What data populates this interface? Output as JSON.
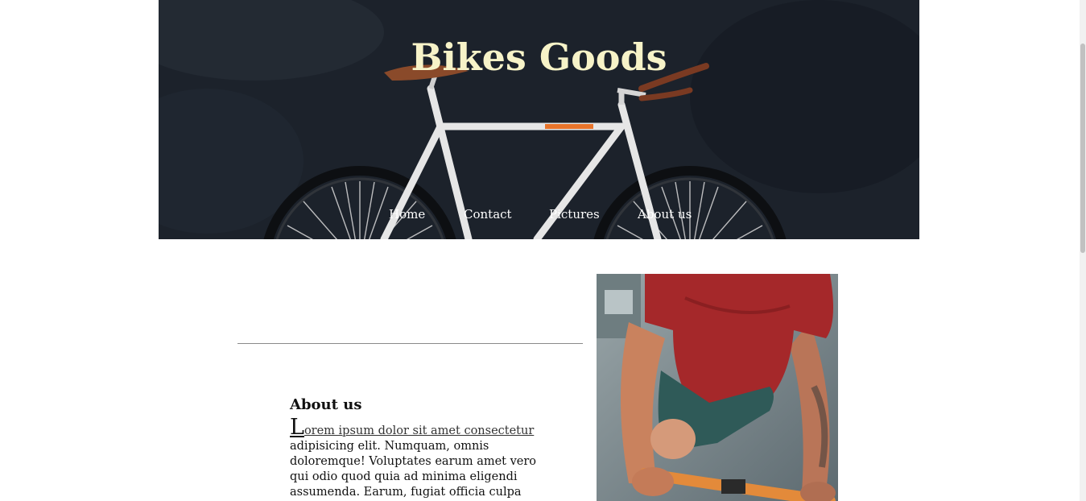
{
  "header": {
    "title": "Bikes Goods"
  },
  "nav": {
    "items": [
      {
        "label": "Home"
      },
      {
        "label": "Contact"
      },
      {
        "label": "Pictures"
      },
      {
        "label": "About us"
      }
    ]
  },
  "about": {
    "heading": "About us",
    "dropcap": "L",
    "lead_link": "orem ipsum dolor sit amet consectetur",
    "body": " adipisicing elit. Numquam, omnis doloremque! Voluptates earum amet vero qui odio quod quia ad minima eligendi assumenda. Earum, fugiat officia culpa"
  },
  "colors": {
    "title": "#f7f3c8",
    "hero_bg": "#1b2029",
    "nav_text": "#ffffff",
    "divider": "#8a8a8a"
  },
  "icons": {
    "hero_image": "bicycle-against-wall",
    "side_image": "cyclist-in-red-shirt"
  }
}
